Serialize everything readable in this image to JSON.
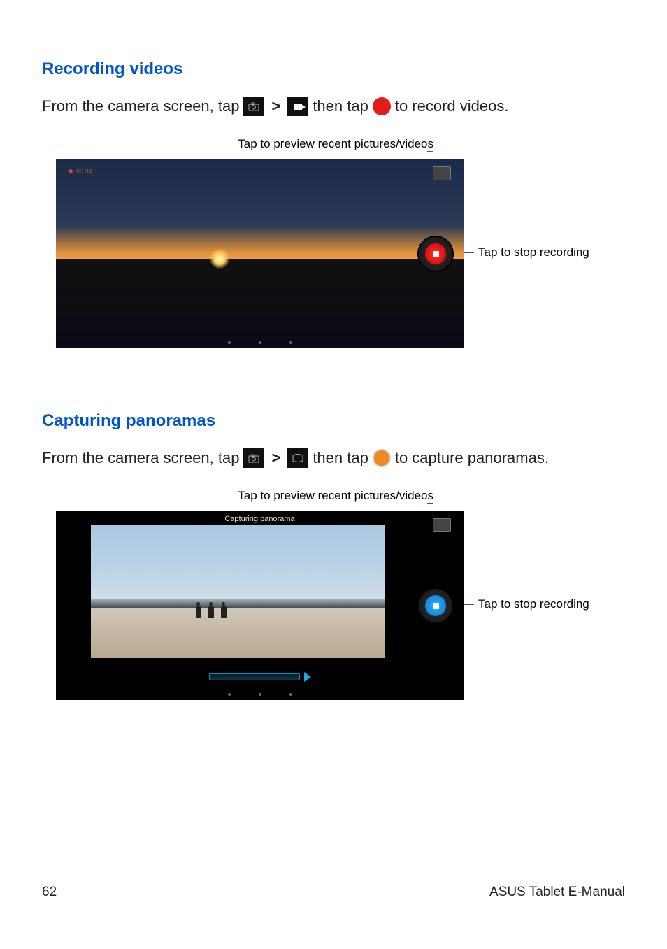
{
  "section1": {
    "heading": "Recording videos",
    "line_pre": "From the camera screen, tap",
    "line_mid": "then tap",
    "line_post": "to record videos.",
    "caption_top": "Tap to preview recent pictures/videos",
    "caption_side": "Tap to stop recording",
    "rec_time": "00.34"
  },
  "section2": {
    "heading": "Capturing panoramas",
    "line_pre": "From the camera screen, tap",
    "line_mid": "then tap",
    "line_post": "to capture panoramas.",
    "caption_top": "Tap to preview recent pictures/videos",
    "caption_side": "Tap to stop recording",
    "overlay_text": "Capturing panorama"
  },
  "footer": {
    "page_number": "62",
    "manual_title": "ASUS Tablet E-Manual"
  }
}
